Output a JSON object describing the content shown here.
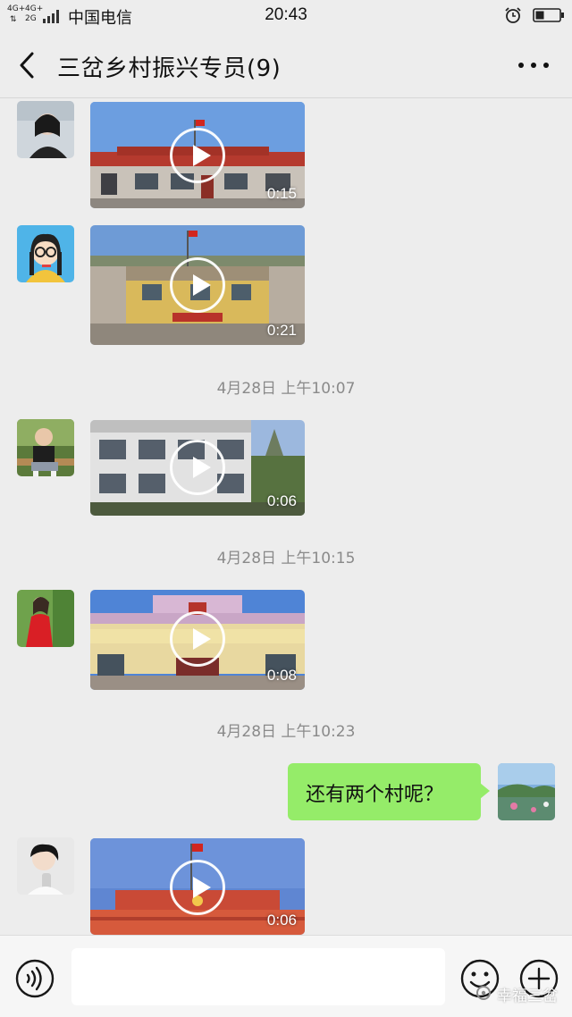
{
  "status_bar": {
    "network_badges": [
      "4G+",
      "4G+",
      "2G"
    ],
    "carrier": "中国电信",
    "time": "20:43",
    "icons": [
      "signal-icon",
      "alarm-icon",
      "battery-icon"
    ]
  },
  "header": {
    "title": "三岔乡村振兴专员(9)",
    "icons": [
      "back-icon",
      "more-icon"
    ]
  },
  "messages": [
    {
      "type": "video",
      "sender": "other",
      "duration": "0:15"
    },
    {
      "type": "video",
      "sender": "other",
      "duration": "0:21"
    },
    {
      "type": "timestamp",
      "text": "4月28日 上午10:07"
    },
    {
      "type": "video",
      "sender": "other",
      "duration": "0:06"
    },
    {
      "type": "timestamp",
      "text": "4月28日 上午10:15"
    },
    {
      "type": "video",
      "sender": "other",
      "duration": "0:08"
    },
    {
      "type": "timestamp",
      "text": "4月28日 上午10:23"
    },
    {
      "type": "text",
      "sender": "self",
      "text": "还有两个村呢？"
    },
    {
      "type": "video",
      "sender": "other",
      "duration": "0:06"
    }
  ],
  "input_bar": {
    "placeholder": "",
    "icons": [
      "voice-icon",
      "emoji-icon",
      "plus-icon"
    ]
  },
  "watermark": {
    "text": "幸福三岔",
    "icon": "wechat-official-account-icon"
  },
  "colors": {
    "background": "#ededed",
    "self_bubble": "#95ec69",
    "timestamp_text": "#8a8a8a",
    "input_bar": "#f6f6f6"
  }
}
